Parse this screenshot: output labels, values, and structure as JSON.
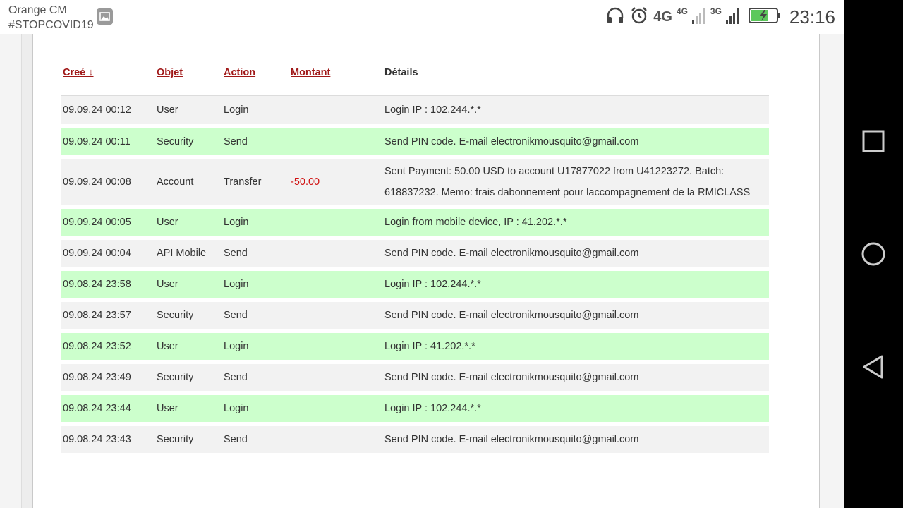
{
  "status_bar": {
    "carrier_line1": "Orange CM",
    "carrier_line2": "#STOPCOVID19",
    "net_4g_big": "4G",
    "net_4g_small": "4G",
    "net_3g": "3G",
    "time": "23:16",
    "icons": [
      "gallery-icon",
      "headphones-icon",
      "alarm-icon",
      "signal-icon",
      "battery-charging-icon"
    ]
  },
  "table": {
    "headers": {
      "created": "Creé ↓",
      "object": "Objet",
      "action": "Action",
      "amount": "Montant",
      "details": "Détails"
    },
    "rows": [
      {
        "created": "09.09.24 00:12",
        "object": "User",
        "action": "Login",
        "amount": "",
        "details": "Login IP : 102.244.*.*"
      },
      {
        "created": "09.09.24 00:11",
        "object": "Security",
        "action": "Send",
        "amount": "",
        "details": "Send PIN code. E-mail electronikmousquito@gmail.com"
      },
      {
        "created": "09.09.24 00:08",
        "object": "Account",
        "action": "Transfer",
        "amount": "-50.00",
        "details": "Sent Payment: 50.00 USD to account U17877022 from U41223272. Batch: 618837232. Memo: frais dabonnement pour laccompagnement de la RMICLASS"
      },
      {
        "created": "09.09.24 00:05",
        "object": "User",
        "action": "Login",
        "amount": "",
        "details": "Login from mobile device, IP : 41.202.*.*"
      },
      {
        "created": "09.09.24 00:04",
        "object": "API Mobile",
        "action": "Send",
        "amount": "",
        "details": "Send PIN code. E-mail electronikmousquito@gmail.com"
      },
      {
        "created": "09.08.24 23:58",
        "object": "User",
        "action": "Login",
        "amount": "",
        "details": "Login IP : 102.244.*.*"
      },
      {
        "created": "09.08.24 23:57",
        "object": "Security",
        "action": "Send",
        "amount": "",
        "details": "Send PIN code. E-mail electronikmousquito@gmail.com"
      },
      {
        "created": "09.08.24 23:52",
        "object": "User",
        "action": "Login",
        "amount": "",
        "details": "Login IP : 41.202.*.*"
      },
      {
        "created": "09.08.24 23:49",
        "object": "Security",
        "action": "Send",
        "amount": "",
        "details": "Send PIN code. E-mail electronikmousquito@gmail.com"
      },
      {
        "created": "09.08.24 23:44",
        "object": "User",
        "action": "Login",
        "amount": "",
        "details": "Login IP : 102.244.*.*"
      },
      {
        "created": "09.08.24 23:43",
        "object": "Security",
        "action": "Send",
        "amount": "",
        "details": "Send PIN code. E-mail electronikmousquito@gmail.com"
      }
    ]
  },
  "colors": {
    "header_link": "#a01818",
    "row_gray": "#f2f2f2",
    "row_green": "#ccffcc",
    "negative_amount": "#d01010"
  }
}
